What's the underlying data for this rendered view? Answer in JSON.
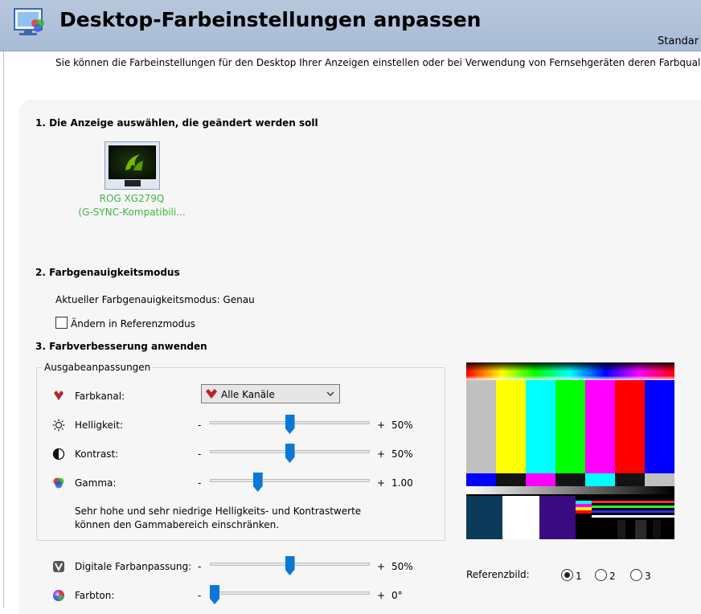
{
  "header": {
    "title": "Desktop-Farbeinstellungen anpassen",
    "right_text": "Standar"
  },
  "intro": "Sie können die Farbeinstellungen für den Desktop Ihrer Anzeigen einstellen oder bei Verwendung von Fernsehgeräten deren Farbqualitä",
  "section1": {
    "title": "1. Die Anzeige auswählen, die geändert werden soll",
    "display_name": "ROG XG279Q",
    "display_detail": "(G-SYNC-Kompatibili..."
  },
  "section2": {
    "title": "2. Farbgenauigkeitsmodus",
    "current_mode": "Aktueller Farbgenauigkeitsmodus: Genau",
    "checkbox_label": "Ändern in Referenzmodus",
    "checkbox_checked": false
  },
  "section3": {
    "title": "3. Farbverbesserung anwenden",
    "group_title": "Ausgabeanpassungen",
    "channel_label": "Farbkanal:",
    "channel_value": "Alle Kanäle",
    "brightness": {
      "label": "Helligkeit:",
      "minus": "-",
      "plus": "+",
      "value": "50%",
      "level": 0.5
    },
    "contrast": {
      "label": "Kontrast:",
      "minus": "-",
      "plus": "+",
      "value": "50%",
      "level": 0.5
    },
    "gamma": {
      "label": "Gamma:",
      "minus": "-",
      "plus": "+",
      "value": "1.00",
      "level": 0.3
    },
    "note_line1": "Sehr hohe und sehr niedrige Helligkeits- und Kontrastwerte",
    "note_line2": "können den Gammabereich einschränken.",
    "vibrance": {
      "label": "Digitale Farbanpassung:",
      "minus": "-",
      "plus": "+",
      "value": "50%",
      "level": 0.5
    },
    "hue": {
      "label": "Farbton:",
      "minus": "-",
      "plus": "+",
      "value": "0°",
      "level": 0.0
    }
  },
  "reference": {
    "label": "Referenzbild:",
    "options": [
      "1",
      "2",
      "3"
    ],
    "selected": "1"
  },
  "colors": {
    "header_bg": "#b0c2da",
    "slider_thumb": "#0a78d7",
    "display_label": "#3fb63f"
  }
}
